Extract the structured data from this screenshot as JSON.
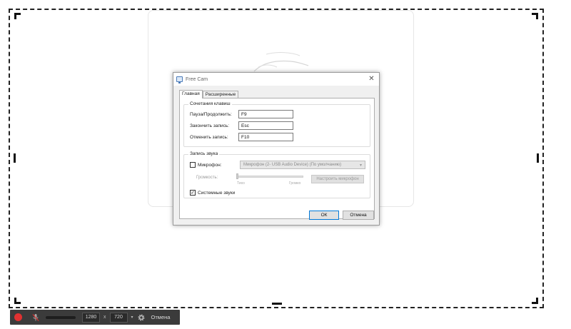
{
  "dialog": {
    "title": "Free Cam",
    "close_glyph": "✕",
    "tabs": [
      {
        "label": "Главная",
        "active": true
      },
      {
        "label": "Расширенные",
        "active": false
      }
    ],
    "hotkeys": {
      "title": "Сочетания клавиш",
      "rows": [
        {
          "label": "Пауза/Продолжить:",
          "value": "F9"
        },
        {
          "label": "Закончить запись:",
          "value": "Esc"
        },
        {
          "label": "Отменить запись:",
          "value": "F10"
        }
      ]
    },
    "sound": {
      "title": "Запись звука",
      "microphone_label": "Микрофон:",
      "microphone_checked": false,
      "microphone_device": "Микрофон (2- USB Audio Device) (По умолчанию)",
      "volume_label": "Громкость:",
      "volume_min_label": "Тихо",
      "volume_max_label": "Громко",
      "volume_level": 0,
      "config_mic_label": "Настроить микрофон",
      "system_sounds_label": "Системные звуки",
      "system_sounds_checked": true
    },
    "ok_label": "ОК",
    "cancel_label": "Отмена"
  },
  "toolbar": {
    "width_value": "1280",
    "times_sign": "x",
    "height_value": "720",
    "cancel_label": "Отмена"
  },
  "colors": {
    "record": "#e03131",
    "toolbar_bg": "#3b3b3b",
    "accent": "#0078d7"
  },
  "icons": [
    "app-icon",
    "close-icon",
    "record-icon",
    "mic-muted-icon",
    "gear-icon",
    "chevron-down-icon",
    "checkbox-check-icon"
  ]
}
